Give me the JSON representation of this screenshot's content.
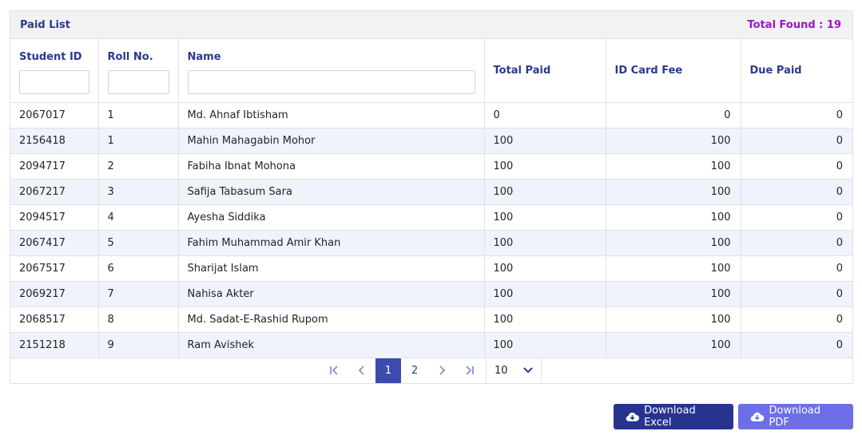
{
  "panel": {
    "title": "Paid List",
    "total_found": "Total Found : 19"
  },
  "columns": [
    "Student ID",
    "Roll No.",
    "Name",
    "Total Paid",
    "ID Card Fee",
    "Due Paid"
  ],
  "rows": [
    {
      "student_id": "2067017",
      "roll": "1",
      "name": "Md. Ahnaf Ibtisham",
      "total_paid": "0",
      "id_card_fee": "0",
      "due_paid": "0"
    },
    {
      "student_id": "2156418",
      "roll": "1",
      "name": "Mahin Mahagabin Mohor",
      "total_paid": "100",
      "id_card_fee": "100",
      "due_paid": "0"
    },
    {
      "student_id": "2094717",
      "roll": "2",
      "name": "Fabiha Ibnat Mohona",
      "total_paid": "100",
      "id_card_fee": "100",
      "due_paid": "0"
    },
    {
      "student_id": "2067217",
      "roll": "3",
      "name": "Safija Tabasum Sara",
      "total_paid": "100",
      "id_card_fee": "100",
      "due_paid": "0"
    },
    {
      "student_id": "2094517",
      "roll": "4",
      "name": "Ayesha Siddika",
      "total_paid": "100",
      "id_card_fee": "100",
      "due_paid": "0"
    },
    {
      "student_id": "2067417",
      "roll": "5",
      "name": "Fahim Muhammad Amir Khan",
      "total_paid": "100",
      "id_card_fee": "100",
      "due_paid": "0"
    },
    {
      "student_id": "2067517",
      "roll": "6",
      "name": "Sharijat Islam",
      "total_paid": "100",
      "id_card_fee": "100",
      "due_paid": "0"
    },
    {
      "student_id": "2069217",
      "roll": "7",
      "name": "Nahisa Akter",
      "total_paid": "100",
      "id_card_fee": "100",
      "due_paid": "0"
    },
    {
      "student_id": "2068517",
      "roll": "8",
      "name": "Md. Sadat-E-Rashid Rupom",
      "total_paid": "100",
      "id_card_fee": "100",
      "due_paid": "0"
    },
    {
      "student_id": "2151218",
      "roll": "9",
      "name": "Ram Avishek",
      "total_paid": "100",
      "id_card_fee": "100",
      "due_paid": "0"
    }
  ],
  "pagination": {
    "first_icon": "first-page-icon",
    "prev_icon": "prev-page-icon",
    "pages": [
      "1",
      "2"
    ],
    "current_page": "1",
    "next_icon": "next-page-icon",
    "last_icon": "last-page-icon",
    "per_page": "10"
  },
  "actions": {
    "excel_label": "Download Excel",
    "pdf_label": "Download PDF",
    "icon": "cloud-download-icon"
  },
  "colors": {
    "accent": "#2a3990",
    "total_found": "#9a16c9",
    "active_page": "#3b4bb0",
    "excel_button": "#27338f",
    "pdf_button": "#6d6ee8",
    "stripe": "#f0f2fc"
  }
}
